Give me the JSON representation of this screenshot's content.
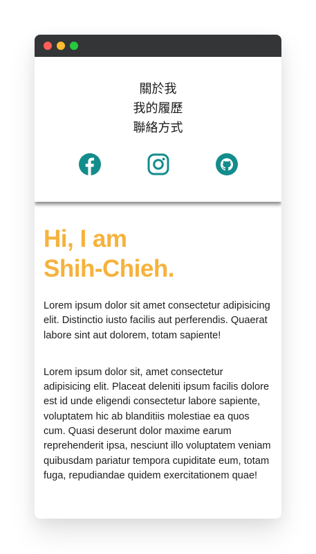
{
  "colors": {
    "titlebar": "#333536",
    "close": "#ff5f57",
    "minimize": "#febc2e",
    "maximize": "#28c840",
    "accent": "#f6b23c",
    "icon": "#138d8b"
  },
  "nav": {
    "items": [
      {
        "label": "關於我"
      },
      {
        "label": "我的履歷"
      },
      {
        "label": "聯絡方式"
      }
    ]
  },
  "socials": [
    {
      "icon": "facebook-icon"
    },
    {
      "icon": "instagram-icon"
    },
    {
      "icon": "github-icon"
    }
  ],
  "hero": {
    "line1": "Hi, I am",
    "line2": "Shih-Chieh."
  },
  "paragraphs": [
    "Lorem ipsum dolor sit amet consectetur adipisicing elit. Distinctio iusto facilis aut perferendis. Quaerat labore sint aut dolorem, totam sapiente!",
    "Lorem ipsum dolor sit, amet consectetur adipisicing elit. Placeat deleniti ipsum facilis dolore est id unde eligendi consectetur labore sapiente, voluptatem hic ab blanditiis molestiae ea quos cum. Quasi deserunt dolor maxime earum reprehenderit ipsa, nesciunt illo voluptatem veniam quibusdam pariatur tempora cupiditate eum, totam fuga, repudiandae quidem exercitationem quae!"
  ]
}
